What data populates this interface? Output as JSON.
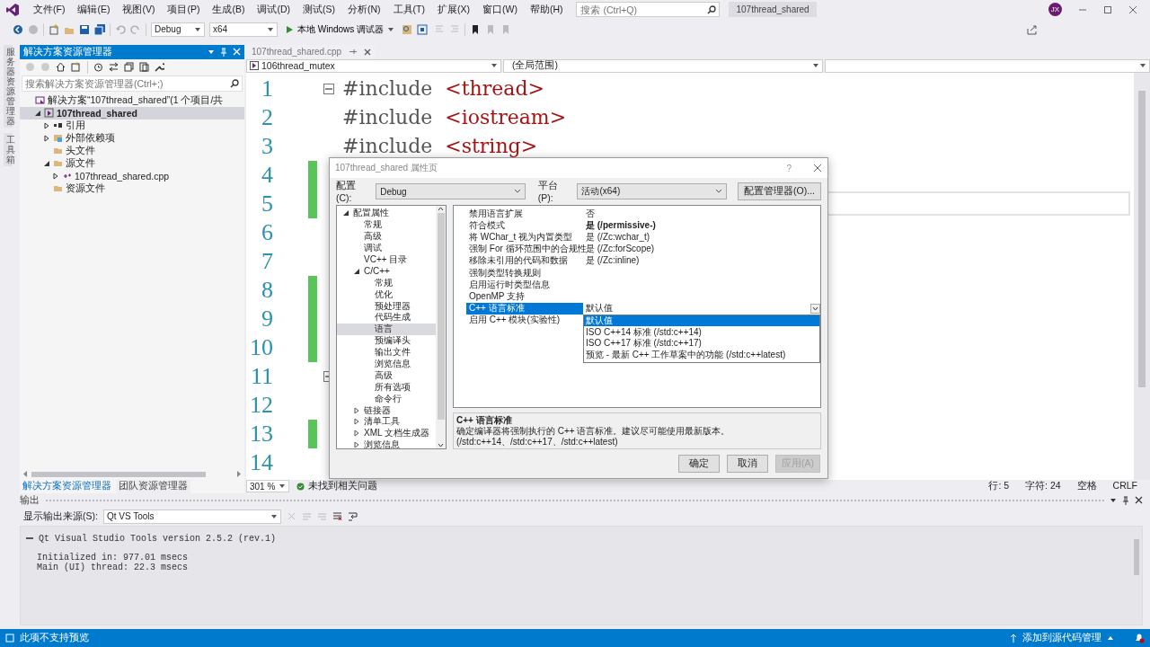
{
  "menu": [
    "文件(F)",
    "编辑(E)",
    "视图(V)",
    "项目(P)",
    "生成(B)",
    "调试(D)",
    "测试(S)",
    "分析(N)",
    "工具(T)",
    "扩展(X)",
    "窗口(W)",
    "帮助(H)"
  ],
  "search": {
    "placeholder": "搜索 (Ctrl+Q)"
  },
  "solution_name": "107thread_shared",
  "avatar": "JX",
  "toolbar": {
    "config": "Debug",
    "platform": "x64",
    "run": "本地 Windows 调试器"
  },
  "side_tabs": [
    "服务器资源管理器",
    "工具箱"
  ],
  "solution_explorer": {
    "title": "解决方案资源管理器",
    "search_placeholder": "搜索解决方案资源管理器(Ctrl+;)",
    "tree": [
      {
        "label": "解决方案“107thread_shared”(1 个项目/共",
        "kind": "solution",
        "selected": false,
        "children": [
          {
            "label": "107thread_shared",
            "kind": "project",
            "expanded": true,
            "selected": true,
            "children": [
              {
                "label": "引用",
                "kind": "references",
                "expanded": false,
                "selected": false
              },
              {
                "label": "外部依赖项",
                "kind": "dependencies",
                "expanded": false,
                "selected": false
              },
              {
                "label": "头文件",
                "kind": "folder",
                "selected": false
              },
              {
                "label": "源文件",
                "kind": "folder",
                "expanded": true,
                "selected": false,
                "children": [
                  {
                    "label": "107thread_shared.cpp",
                    "kind": "file",
                    "expanded": false,
                    "selected": false
                  }
                ]
              },
              {
                "label": "资源文件",
                "kind": "folder",
                "selected": false
              }
            ]
          }
        ]
      }
    ],
    "tabs": [
      {
        "label": "解决方案资源管理器",
        "selected": true
      },
      {
        "label": "团队资源管理器",
        "selected": false
      }
    ]
  },
  "editor": {
    "tab": "107thread_shared.cpp",
    "project_scope": "106thread_mutex",
    "scope": "(全局范围)",
    "lines": [
      {
        "number": "1",
        "fold": true,
        "changed": false,
        "current": false,
        "tokens": [
          {
            "text": "#include",
            "kind": "preprocessor"
          },
          {
            "text": "<thread>",
            "kind": "string"
          }
        ]
      },
      {
        "number": "2",
        "fold": false,
        "changed": false,
        "current": false,
        "tokens": [
          {
            "text": "#include",
            "kind": "preprocessor"
          },
          {
            "text": "<iostream>",
            "kind": "string"
          }
        ]
      },
      {
        "number": "3",
        "fold": false,
        "changed": false,
        "current": false,
        "tokens": [
          {
            "text": "#include",
            "kind": "preprocessor"
          },
          {
            "text": "<string>",
            "kind": "string"
          }
        ]
      },
      {
        "number": "4",
        "fold": false,
        "changed": true,
        "current": false
      },
      {
        "number": "5",
        "fold": false,
        "changed": true,
        "current": true
      },
      {
        "number": "6",
        "fold": false,
        "changed": false,
        "current": false
      },
      {
        "number": "7",
        "fold": false,
        "changed": false,
        "current": false
      },
      {
        "number": "8",
        "fold": false,
        "changed": true,
        "current": false
      },
      {
        "number": "9",
        "fold": false,
        "changed": true,
        "current": false
      },
      {
        "number": "10",
        "fold": false,
        "changed": true,
        "current": false
      },
      {
        "number": "11",
        "fold": true,
        "changed": false,
        "current": false
      },
      {
        "number": "12",
        "fold": false,
        "changed": false,
        "current": false
      },
      {
        "number": "13",
        "fold": false,
        "changed": true,
        "current": false
      },
      {
        "number": "14",
        "fold": false,
        "changed": false,
        "current": false
      }
    ],
    "zoom": "301 %",
    "issues": "未找到相关问题",
    "position": [
      "行: 5",
      "字符: 24",
      "空格",
      "CRLF"
    ]
  },
  "dialog": {
    "title": "107thread_shared 属性页",
    "help": "?",
    "config_label": "配置(C):",
    "config": "Debug",
    "platform_label": "平台(P):",
    "platform": "活动(x64)",
    "manager_button": "配置管理器(O)...",
    "tree": [
      {
        "label": "配置属性",
        "expanded": true,
        "selected": false,
        "children": [
          {
            "label": "常规",
            "selected": false
          },
          {
            "label": "高级",
            "selected": false
          },
          {
            "label": "调试",
            "selected": false
          },
          {
            "label": "VC++ 目录",
            "selected": false
          },
          {
            "label": "C/C++",
            "expanded": true,
            "selected": false,
            "children": [
              {
                "label": "常规",
                "selected": false
              },
              {
                "label": "优化",
                "selected": false
              },
              {
                "label": "预处理器",
                "selected": false
              },
              {
                "label": "代码生成",
                "selected": false
              },
              {
                "label": "语言",
                "selected": true
              },
              {
                "label": "预编译头",
                "selected": false
              },
              {
                "label": "输出文件",
                "selected": false
              },
              {
                "label": "浏览信息",
                "selected": false
              },
              {
                "label": "高级",
                "selected": false
              },
              {
                "label": "所有选项",
                "selected": false
              },
              {
                "label": "命令行",
                "selected": false
              }
            ]
          },
          {
            "label": "链接器",
            "expanded": false,
            "selected": false
          },
          {
            "label": "清单工具",
            "expanded": false,
            "selected": false
          },
          {
            "label": "XML 文档生成器",
            "expanded": false,
            "selected": false
          },
          {
            "label": "浏览信息",
            "expanded": false,
            "selected": false
          }
        ]
      }
    ],
    "properties": [
      {
        "name": "禁用语言扩展",
        "value": "否",
        "modified": false,
        "selected": false
      },
      {
        "name": "符合模式",
        "value": "是 (/permissive-)",
        "modified": true,
        "selected": false
      },
      {
        "name": "将 WChar_t 视为内置类型",
        "value": "是 (/Zc:wchar_t)",
        "modified": false,
        "selected": false
      },
      {
        "name": "强制 For 循环范围中的合规性",
        "value": "是 (/Zc:forScope)",
        "modified": false,
        "selected": false
      },
      {
        "name": "移除未引用的代码和数据",
        "value": "是 (/Zc:inline)",
        "modified": false,
        "selected": false
      },
      {
        "name": "强制类型转换规则",
        "selected": false
      },
      {
        "name": "启用运行时类型信息",
        "selected": false
      },
      {
        "name": "OpenMP 支持",
        "selected": false
      },
      {
        "name": "C++ 语言标准",
        "value": "默认值",
        "modified": false,
        "selected": true
      },
      {
        "name": "启用 C++ 模块(实验性)",
        "selected": false
      }
    ],
    "dropdown": [
      {
        "label": "默认值",
        "selected": true
      },
      {
        "label": "ISO C++14 标准 (/std:c++14)",
        "selected": false
      },
      {
        "label": "ISO C++17 标准 (/std:c++17)",
        "selected": false
      },
      {
        "label": "预览 - 最新 C++ 工作草案中的功能 (/std:c++latest)",
        "selected": false
      }
    ],
    "description_title": "C++ 语言标准",
    "description": "确定编译器将强制执行的 C++ 语言标准。建议尽可能使用最新版本。(/std:c++14、/std:c++17、/std:c++latest)",
    "buttons": [
      {
        "label": "确定",
        "disabled": false
      },
      {
        "label": "取消",
        "disabled": false
      },
      {
        "label": "应用(A)",
        "disabled": true
      }
    ]
  },
  "output": {
    "title": "输出",
    "source_label": "显示输出来源(S):",
    "source": "Qt VS Tools",
    "header": "Qt Visual Studio Tools version 2.5.2 (rev.1)",
    "lines": [
      "Initialized in: 977.01 msecs",
      "Main (UI) thread: 22.3 msecs"
    ]
  },
  "status_bar": {
    "message": "此项不支持预览",
    "source_control": "添加到源代码管理"
  }
}
